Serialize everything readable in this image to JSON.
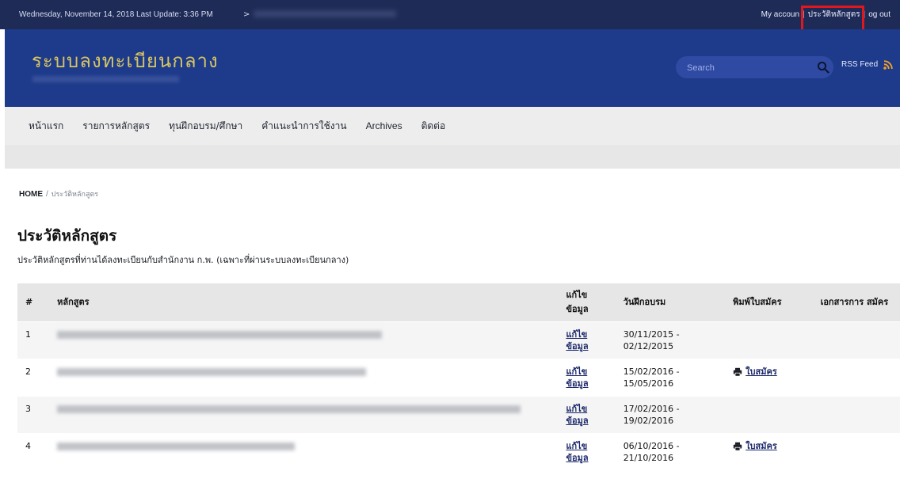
{
  "topbar": {
    "date_text": "Wednesday, November 14, 2018 Last Update: 3:36 PM",
    "arrow": ">",
    "links": {
      "my_account": "My accoun",
      "history": "ประวัติหลักสูตร",
      "logout": "og out"
    }
  },
  "header": {
    "title": "ระบบลงทะเบียนกลาง",
    "search_placeholder": "Search",
    "rss_label": "RSS Feed"
  },
  "nav": {
    "items": [
      "หน้าแรก",
      "รายการหลักสูตร",
      "ทุนฝึกอบรม/ศึกษา",
      "คำแนะนำการใช้งาน",
      "Archives",
      "ติดต่อ"
    ]
  },
  "breadcrumb": {
    "home": "HOME",
    "sep": "/",
    "current": "ประวัติหลักสูตร"
  },
  "page": {
    "title": "ประวัติหลักสูตร",
    "description": "ประวัติหลักสูตรที่ท่านได้ลงทะเบียนกับสำนักงาน ก.พ. (เฉพาะที่ผ่านระบบลงทะเบียนกลาง)"
  },
  "table": {
    "headers": {
      "num": "#",
      "course": "หลักสูตร",
      "edit": "แก้ไข ข้อมูล",
      "date": "วันฝึกอบรม",
      "print": "พิมพ์ใบสมัคร",
      "doc": "เอกสารการ สมัคร"
    },
    "rows": [
      {
        "num": "1",
        "edit": "แก้ไข ข้อมูล",
        "date": "30/11/2015 - 02/12/2015",
        "print": ""
      },
      {
        "num": "2",
        "edit": "แก้ไข ข้อมูล",
        "date": "15/02/2016 - 15/05/2016",
        "print": "ใบสมัคร"
      },
      {
        "num": "3",
        "edit": "แก้ไข ข้อมูล",
        "date": "17/02/2016 - 19/02/2016",
        "print": ""
      },
      {
        "num": "4",
        "edit": "แก้ไข ข้อมูล",
        "date": "06/10/2016 - 21/10/2016",
        "print": "ใบสมัคร"
      }
    ]
  },
  "icons": {
    "search": "search-icon",
    "rss": "rss-icon",
    "printer": "printer-icon"
  },
  "colors": {
    "topbar": "#1e2b56",
    "header": "#1e3a8a",
    "title_gold": "#d7c562",
    "highlight_red": "#e0171c",
    "link": "#1d2a6b",
    "rss_orange": "#f0a12a"
  }
}
